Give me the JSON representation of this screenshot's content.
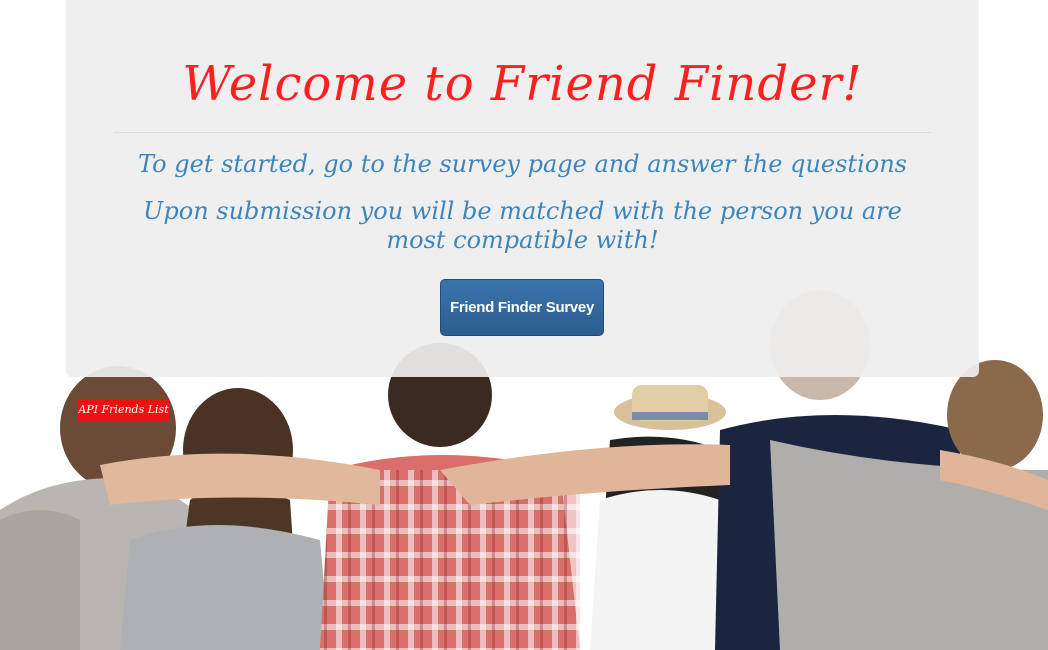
{
  "jumbotron": {
    "title": "Welcome to Friend Finder!",
    "lead_line_1": "To get started, go to the survey page and answer the questions",
    "lead_line_2": "Upon submission you will be matched with the person you are most compatible with!",
    "survey_button_label": "Friend Finder Survey"
  },
  "links": {
    "api_friends_list": "API Friends List"
  },
  "colors": {
    "title": "#ff1f1f",
    "lead_text": "#3c86bd",
    "button": "#2e6094",
    "api_link_bg": "#ee1111",
    "jumbotron_bg": "#eeeeee"
  },
  "background": {
    "image": "group-of-friends-arms-around-shoulders-photo"
  }
}
